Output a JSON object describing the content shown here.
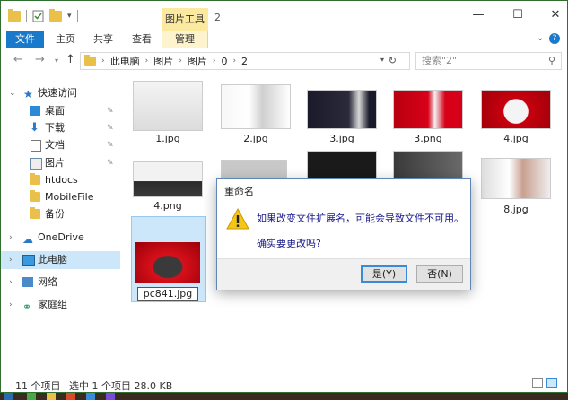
{
  "window": {
    "context_tab": "图片工具",
    "title": "2",
    "caption_buttons": [
      "—",
      "☐",
      "✕"
    ]
  },
  "ribbon": {
    "tabs": [
      "文件",
      "主页",
      "共享",
      "查看",
      "管理"
    ]
  },
  "address": {
    "breadcrumbs": [
      "此电脑",
      "图片",
      "图片",
      "0",
      "2"
    ],
    "search_placeholder": "搜索\"2\""
  },
  "nav": {
    "items": [
      {
        "label": "快速访问",
        "icon": "star-icon",
        "pinned": false
      },
      {
        "label": "桌面",
        "icon": "desktop-icon",
        "pinned": true
      },
      {
        "label": "下载",
        "icon": "download-icon",
        "pinned": true
      },
      {
        "label": "文档",
        "icon": "document-icon",
        "pinned": true
      },
      {
        "label": "图片",
        "icon": "pictures-icon",
        "pinned": true
      },
      {
        "label": "htdocs",
        "icon": "folder-icon",
        "pinned": false
      },
      {
        "label": "MobileFile",
        "icon": "folder-icon",
        "pinned": false
      },
      {
        "label": "备份",
        "icon": "folder-icon",
        "pinned": false
      },
      {
        "label": "OneDrive",
        "icon": "cloud-icon",
        "pinned": false
      },
      {
        "label": "此电脑",
        "icon": "computer-icon",
        "pinned": false
      },
      {
        "label": "网络",
        "icon": "network-icon",
        "pinned": false
      },
      {
        "label": "家庭组",
        "icon": "homegroup-icon",
        "pinned": false
      }
    ]
  },
  "files": [
    {
      "name": "1.jpg"
    },
    {
      "name": "2.jpg"
    },
    {
      "name": "3.jpg"
    },
    {
      "name": "3.png"
    },
    {
      "name": "4.jpg"
    },
    {
      "name": "4.png"
    },
    {
      "name": "8.jpg"
    },
    {
      "name": "pc841.jpg"
    }
  ],
  "status": {
    "count": "11 个项目",
    "selection": "选中 1 个项目  28.0 KB"
  },
  "dialog": {
    "title": "重命名",
    "message": "如果改变文件扩展名，可能会导致文件不可用。",
    "question": "确实要更改吗?",
    "yes": "是(Y)",
    "no": "否(N)"
  },
  "colors": {
    "accent": "#1979ca",
    "selection": "#cce6fa",
    "context_tab": "#fbe9a0",
    "dialog_text": "#1a1a8a"
  }
}
